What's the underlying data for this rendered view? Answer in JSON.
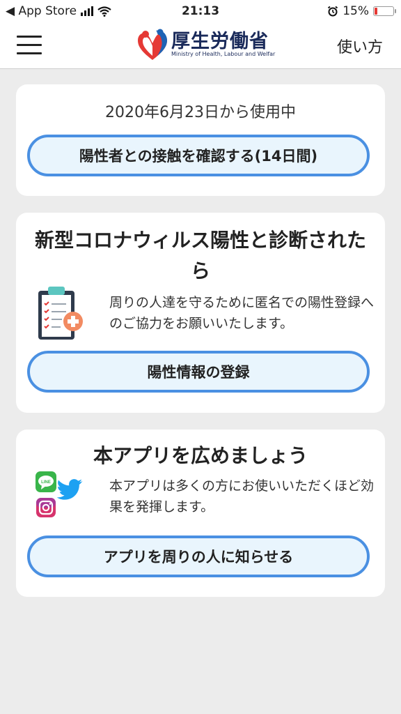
{
  "status_bar": {
    "back_label": "◀ App Store",
    "time": "21:13",
    "battery_text": "15%",
    "battery_level": 0.15,
    "battery_color": "#e53935"
  },
  "navbar": {
    "brand_title": "厚生労働省",
    "brand_subtitle": "Ministry of Health, Labour and Welfar",
    "howto_label": "使い方"
  },
  "card_usage": {
    "since_text": "2020年6月23日から使用中",
    "check_button": "陽性者との接触を確認する(14日間)"
  },
  "card_positive": {
    "title": "新型コロナウィルス陽性と診断されたら",
    "description": "周りの人達を守るために匿名での陽性登録へのご協力をお願いいたします。",
    "register_button": "陽性情報の登録",
    "icon": "clipboard-checklist-icon"
  },
  "card_share": {
    "title": "本アプリを広めましょう",
    "description": "本アプリは多くの方にお使いいただくほど効果を発揮します。",
    "share_button": "アプリを周りの人に知らせる",
    "line_icon_text": "LINE",
    "icons": [
      "line-icon",
      "twitter-icon",
      "instagram-icon"
    ]
  },
  "colors": {
    "accent": "#4a90e2",
    "button_bg": "#e9f5fd",
    "page_bg": "#ececec"
  }
}
